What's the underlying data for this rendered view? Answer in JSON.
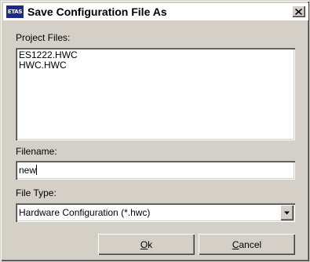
{
  "window": {
    "app_icon_text": "ETAS",
    "title": "Save Configuration File As"
  },
  "project_files": {
    "label": "Project Files:",
    "items": [
      "ES1222.HWC",
      "HWC.HWC"
    ]
  },
  "filename": {
    "label": "Filename:",
    "value": "new"
  },
  "file_type": {
    "label": "File Type:",
    "selected": "Hardware Configuration (*.hwc)"
  },
  "buttons": {
    "ok": {
      "underline": "O",
      "rest": "k"
    },
    "cancel": {
      "underline": "C",
      "rest": "ancel"
    }
  },
  "icons": {
    "close": "close-icon",
    "dropdown": "chevron-down-icon"
  }
}
